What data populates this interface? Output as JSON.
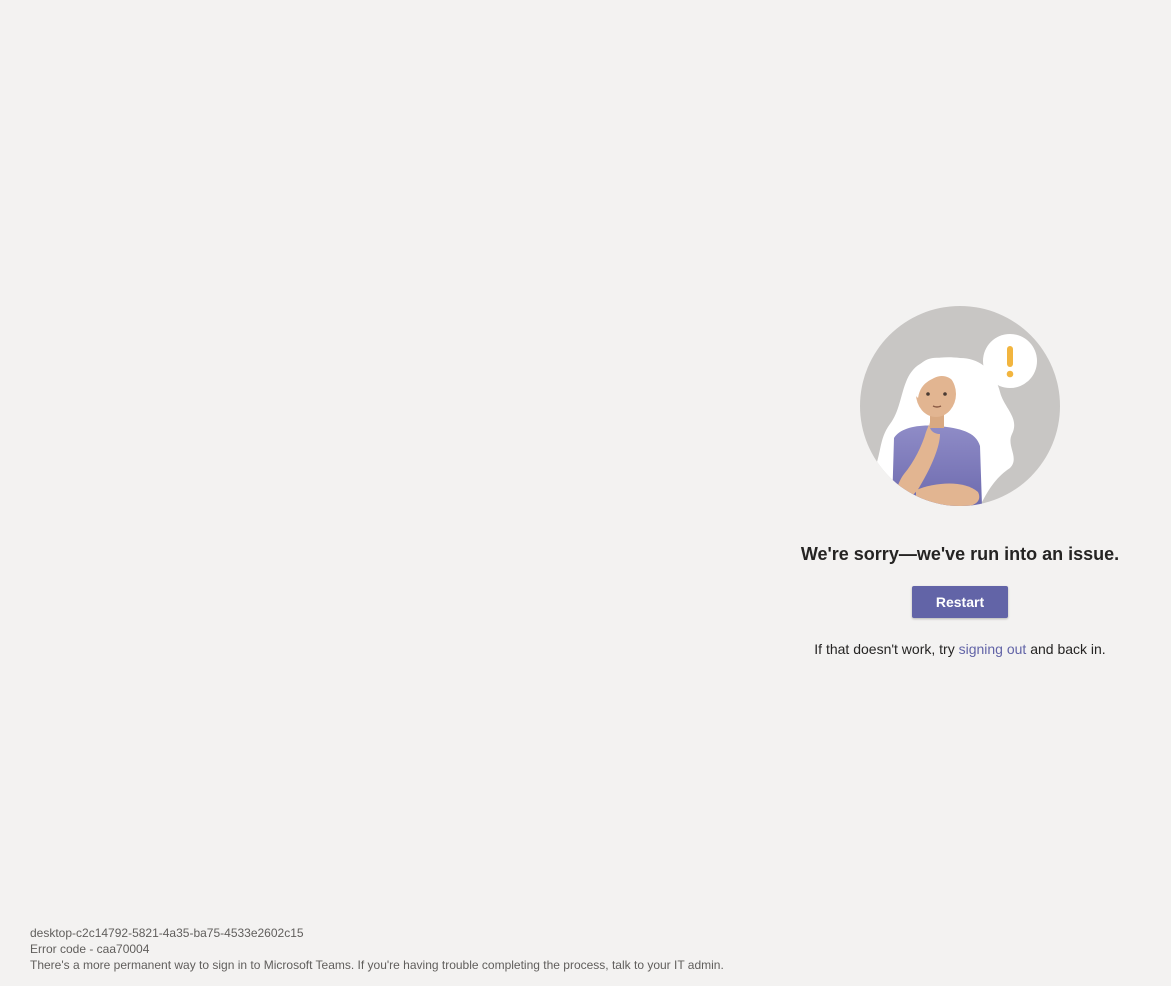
{
  "error": {
    "heading": "We're sorry—we've run into an issue.",
    "restart_label": "Restart",
    "help_prefix": "If that doesn't work, try ",
    "help_link": "signing out",
    "help_suffix": " and back in.",
    "illustration_icon": "person-thinking-exclamation-icon"
  },
  "footer": {
    "session_id": "desktop-c2c14792-5821-4a35-ba75-4533e2602c15",
    "error_code": "Error code - caa70004",
    "info": "There's a more permanent way to sign in to Microsoft Teams. If you're having trouble completing the process, talk to your IT admin."
  },
  "colors": {
    "background": "#f3f2f1",
    "accent": "#6264a7",
    "text": "#252423",
    "muted_text": "#605e5c",
    "exclamation": "#f2b53f"
  }
}
